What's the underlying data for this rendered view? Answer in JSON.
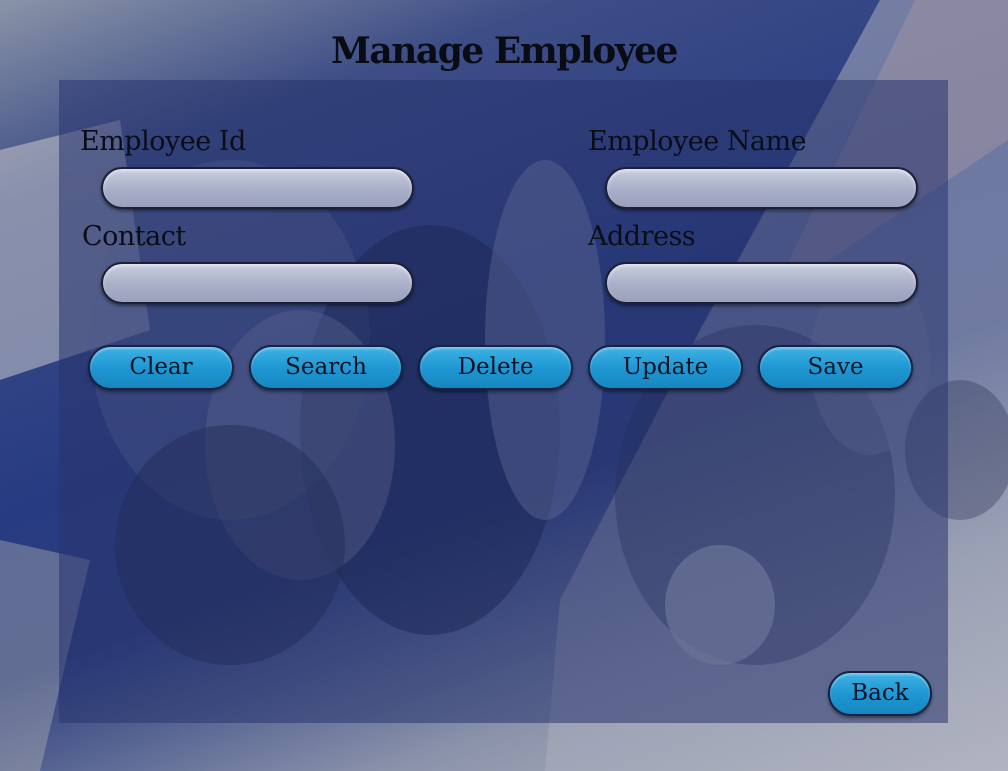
{
  "page": {
    "title": "Manage Employee"
  },
  "form": {
    "employee_id": {
      "label": "Employee Id",
      "value": "",
      "placeholder": ""
    },
    "employee_name": {
      "label": "Employee Name",
      "value": "",
      "placeholder": ""
    },
    "contact": {
      "label": "Contact",
      "value": "",
      "placeholder": ""
    },
    "address": {
      "label": "Address",
      "value": "",
      "placeholder": ""
    }
  },
  "actions": {
    "clear_label": "Clear",
    "search_label": "Search",
    "delete_label": "Delete",
    "update_label": "Update",
    "save_label": "Save",
    "back_label": "Back"
  },
  "colors": {
    "button_fill": "#1f98d3",
    "input_fill": "#a9afc8",
    "panel_overlay": "#28346e",
    "text": "#0b0d16"
  }
}
